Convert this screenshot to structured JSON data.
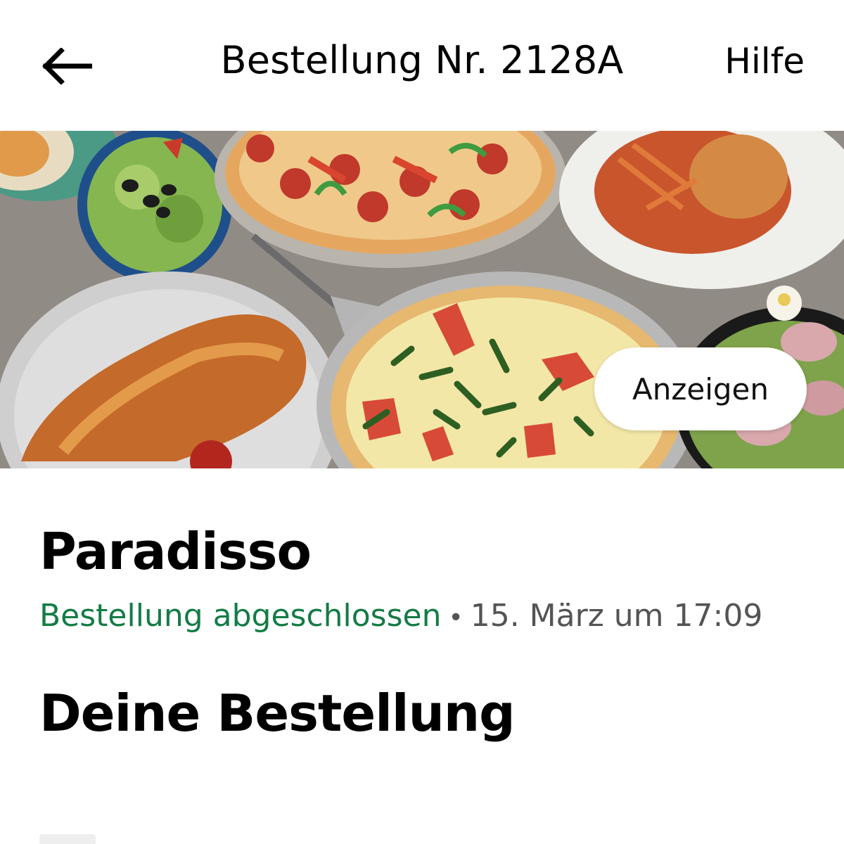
{
  "header": {
    "back_icon": "arrow-left-icon",
    "title": "Bestellung Nr. 2128A",
    "help_label": "Hilfe"
  },
  "hero": {
    "image_subject": "food-spread-image",
    "show_button_label": "Anzeigen"
  },
  "restaurant": {
    "name": "Paradisso",
    "status": "Bestellung abgeschlossen",
    "separator": "•",
    "date": "15. März um 17:09"
  },
  "order_section": {
    "title": "Deine Bestellung"
  },
  "colors": {
    "status_green": "#137c45",
    "text_primary": "#000000",
    "text_secondary": "#545454"
  }
}
